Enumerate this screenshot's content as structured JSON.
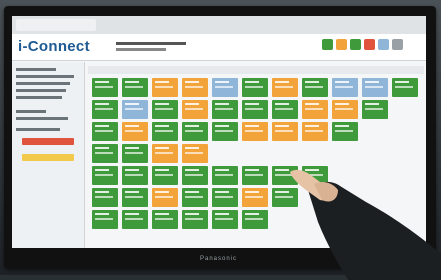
{
  "app": {
    "logo_text": "i-Connect",
    "brand": "Panasonic"
  },
  "colors": {
    "green": "#3f9a3c",
    "orange": "#f2a33a",
    "blue": "#8fb6d9",
    "red": "#e0533d",
    "accent": "#1f5a93"
  },
  "icons": [
    "toolbar-icon-green",
    "toolbar-icon-orange",
    "toolbar-icon-green",
    "toolbar-icon-red",
    "toolbar-icon-blue",
    "toolbar-icon-grey"
  ]
}
